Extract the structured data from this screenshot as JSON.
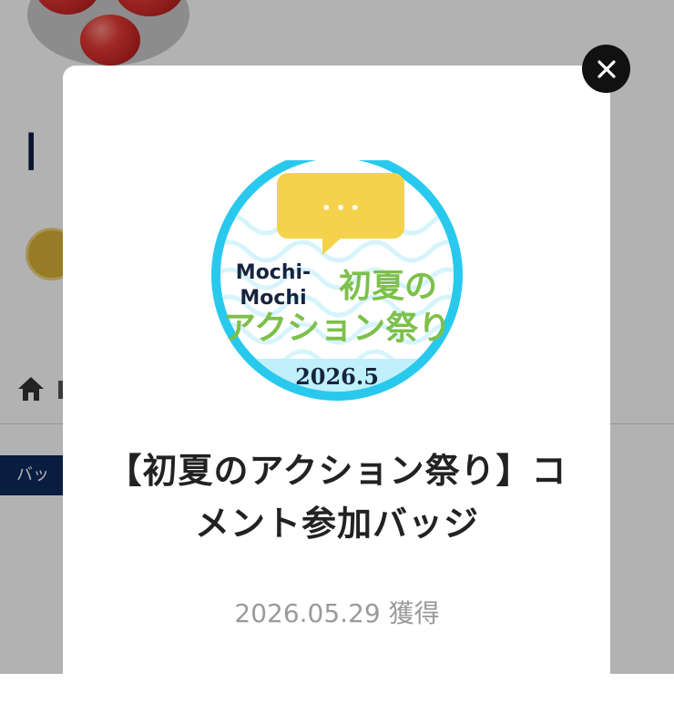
{
  "background": {
    "chip_label": "バッ",
    "avatar_alt": "tomato photo"
  },
  "modal": {
    "close_icon": "close-icon",
    "badge": {
      "emblem_line1": "Mochi-",
      "emblem_line2": "Mochi",
      "emblem_title_top": "初夏の",
      "emblem_title_bottom": "アクション祭り",
      "emblem_year": "2026.5",
      "speech_bubble_dots": "• • •",
      "colors": {
        "ring": "#29c9ee",
        "bubble": "#f5d24b",
        "title_green": "#7dc04a",
        "banner": "#bff0fb",
        "text_navy": "#16243f"
      }
    },
    "title": "【初夏のアクション祭り】コメント参加バッジ",
    "acquired": "2026.05.29 獲得"
  }
}
